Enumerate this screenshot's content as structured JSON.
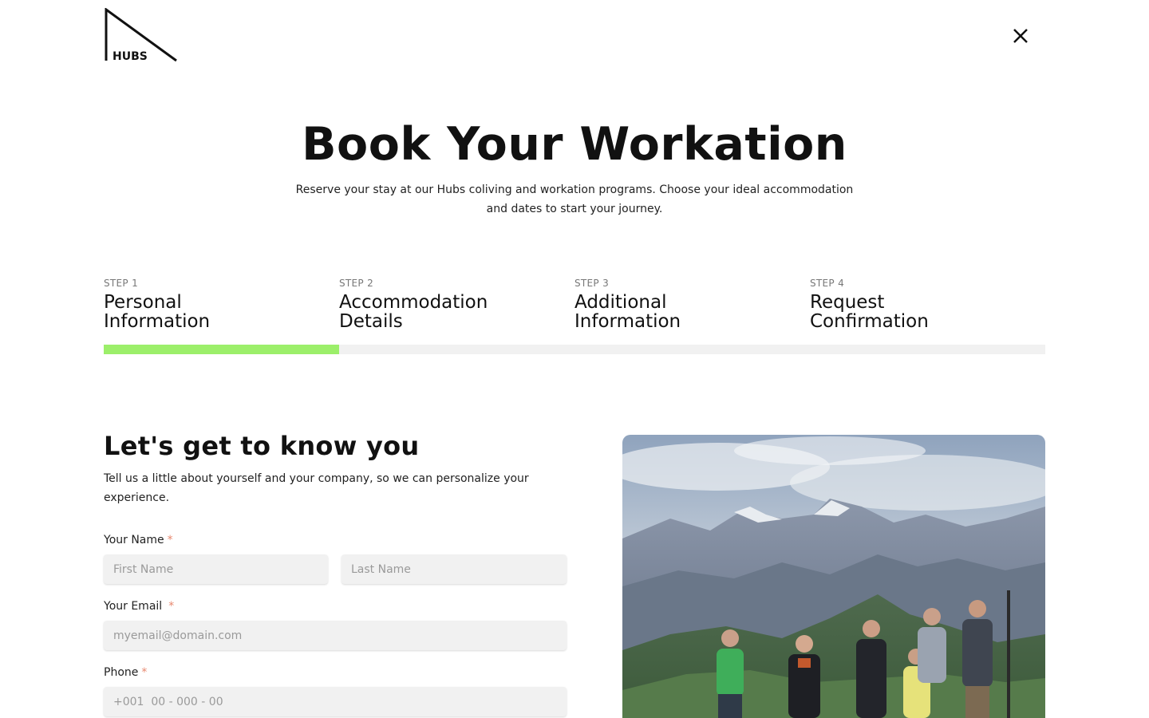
{
  "brand": {
    "logo_text": "HUBS"
  },
  "header": {
    "close_icon": "close-icon"
  },
  "hero": {
    "title": "Book Your Workation",
    "subtitle_line1": "Reserve your stay at our Hubs coliving and workation programs.  Choose your ideal accommodation",
    "subtitle_line2": "and dates to start your journey."
  },
  "steps": [
    {
      "number": "STEP 1",
      "title_line1": "Personal",
      "title_line2": "Information"
    },
    {
      "number": "STEP 2",
      "title_line1": "Accommodation",
      "title_line2": "Details"
    },
    {
      "number": "STEP 3",
      "title_line1": "Additional",
      "title_line2": "Information"
    },
    {
      "number": "STEP 4",
      "title_line1": "Request",
      "title_line2": "Confirmation"
    }
  ],
  "progress": {
    "current_step": 1,
    "total_steps": 4,
    "fraction": 0.25,
    "fill_color": "#9cef6a"
  },
  "form": {
    "title": "Let's get to know you",
    "description": "Tell us a little about yourself and your company, so we can personalize your experience.",
    "name": {
      "label": "Your Name",
      "required_mark": "*",
      "first_placeholder": "First Name",
      "last_placeholder": "Last Name"
    },
    "email": {
      "label": "Your Email",
      "required_mark": "*",
      "placeholder": "myemail@domain.com"
    },
    "phone": {
      "label": "Phone",
      "required_mark": "*",
      "placeholder": "+001  00 - 000 - 00"
    }
  },
  "image": {
    "subject": "group-photo-mountains"
  },
  "colors": {
    "accent": "#9cef6a",
    "required": "#e8886f",
    "field_bg": "#f1f1f1"
  }
}
